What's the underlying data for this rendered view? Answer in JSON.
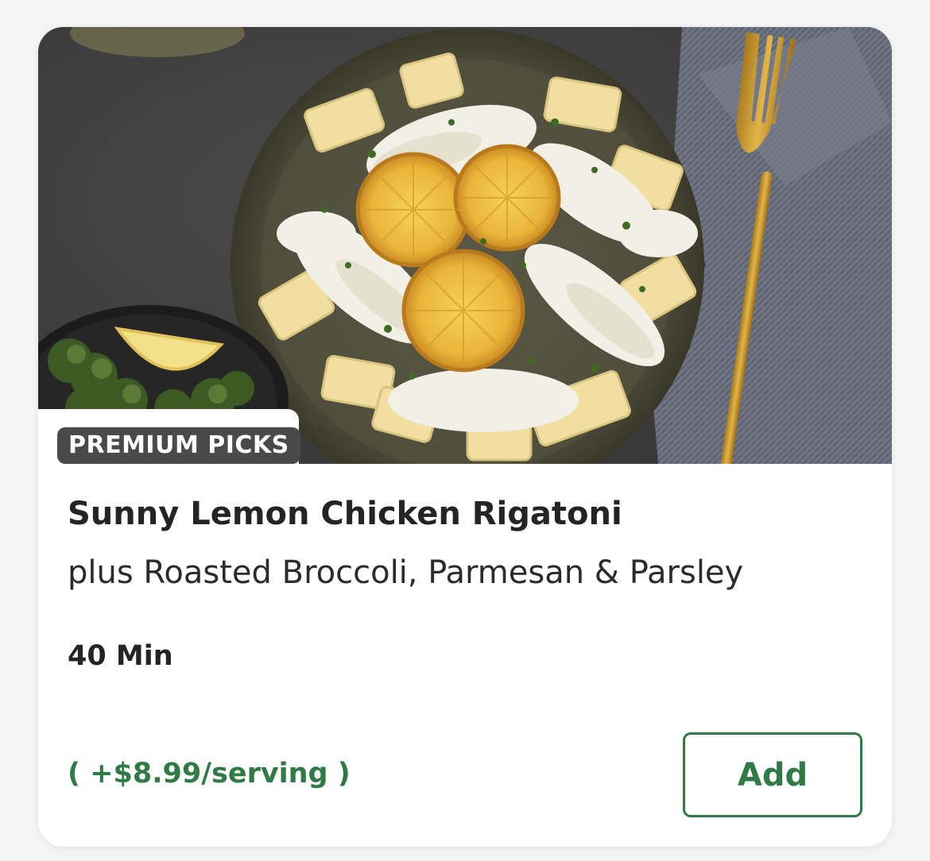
{
  "recipe": {
    "badge": "PREMIUM PICKS",
    "title": "Sunny Lemon Chicken Rigatoni",
    "subtitle": "plus Roasted Broccoli, Parmesan & Parsley",
    "time": "40 Min",
    "price": "( +$8.99/serving )",
    "add_label": "Add"
  },
  "colors": {
    "accent": "#2f7a45",
    "badge_bg": "#4a4a4a",
    "title": "#242424"
  },
  "image": {
    "subject": "lemon chicken rigatoni plate with lemon slices, broccoli side dish, gold fork and gray napkin"
  }
}
